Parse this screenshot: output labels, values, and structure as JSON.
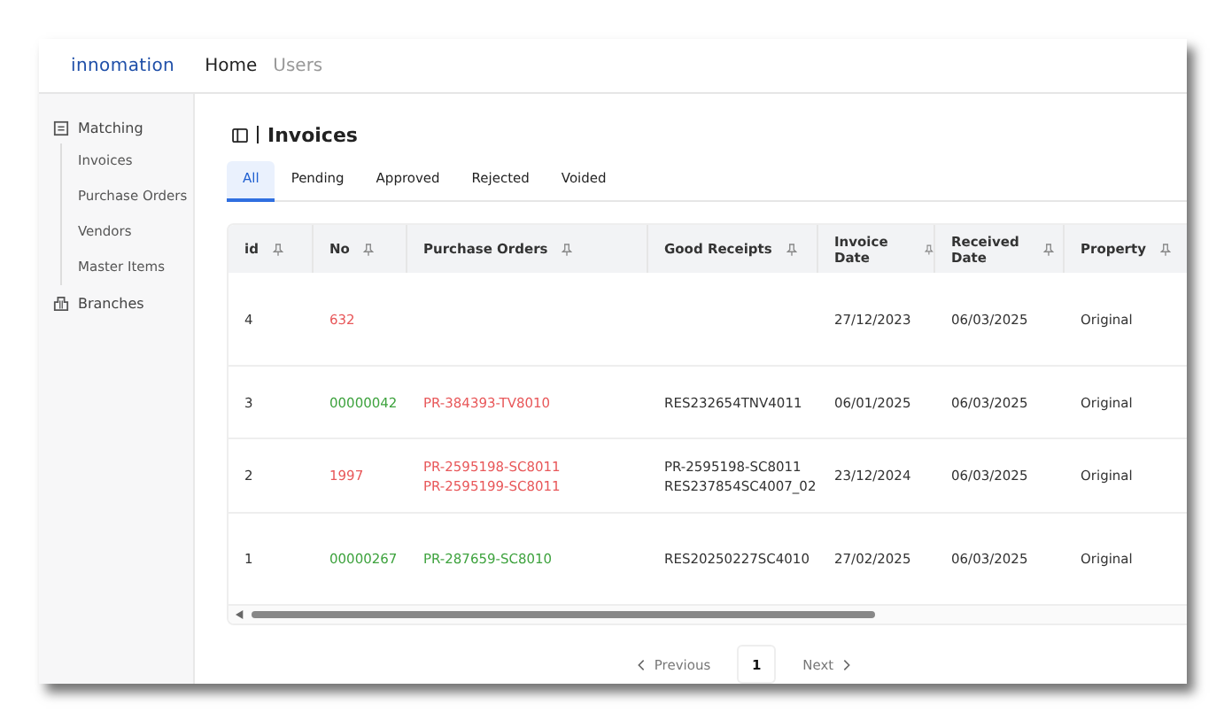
{
  "header": {
    "logo": "innomation",
    "nav": [
      {
        "label": "Home",
        "selected": true
      },
      {
        "label": "Users",
        "selected": false
      }
    ]
  },
  "sidebar": {
    "items": [
      {
        "label": "Matching",
        "kind": "group",
        "children": [
          {
            "label": "Invoices"
          },
          {
            "label": "Purchase Orders"
          },
          {
            "label": "Vendors"
          },
          {
            "label": "Master Items"
          }
        ]
      },
      {
        "label": "Branches",
        "kind": "link"
      }
    ]
  },
  "page": {
    "title": "Invoices"
  },
  "tabs": [
    {
      "label": "All",
      "selected": true
    },
    {
      "label": "Pending",
      "selected": false
    },
    {
      "label": "Approved",
      "selected": false
    },
    {
      "label": "Rejected",
      "selected": false
    },
    {
      "label": "Voided",
      "selected": false
    }
  ],
  "table": {
    "columns": [
      "id",
      "No",
      "Purchase Orders",
      "Good Receipts",
      "Invoice Date",
      "Received Date",
      "Property"
    ],
    "rows": [
      {
        "id": "4",
        "no": {
          "text": "632",
          "color": "#e8585a"
        },
        "purchase_orders": [],
        "good_receipts": [],
        "invoice_date": "27/12/2023",
        "received_date": "06/03/2025",
        "property": "Original"
      },
      {
        "id": "3",
        "no": {
          "text": "00000042",
          "color": "#3fa33f"
        },
        "purchase_orders": [
          {
            "text": "PR-384393-TV8010",
            "color": "#e8585a"
          }
        ],
        "good_receipts": [
          "RES232654TNV4011"
        ],
        "invoice_date": "06/01/2025",
        "received_date": "06/03/2025",
        "property": "Original"
      },
      {
        "id": "2",
        "no": {
          "text": "1997",
          "color": "#e8585a"
        },
        "purchase_orders": [
          {
            "text": "PR-2595198-SC8011",
            "color": "#e8585a"
          },
          {
            "text": "PR-2595199-SC8011",
            "color": "#e8585a"
          }
        ],
        "good_receipts": [
          "PR-2595198-SC8011",
          "RES237854SC4007_02"
        ],
        "invoice_date": "23/12/2024",
        "received_date": "06/03/2025",
        "property": "Original"
      },
      {
        "id": "1",
        "no": {
          "text": "00000267",
          "color": "#3fa33f"
        },
        "purchase_orders": [
          {
            "text": "PR-287659-SC8010",
            "color": "#3fa33f"
          }
        ],
        "good_receipts": [
          "RES20250227SC4010"
        ],
        "invoice_date": "27/02/2025",
        "received_date": "06/03/2025",
        "property": "Original"
      }
    ]
  },
  "pagination": {
    "previous": "Previous",
    "pages": [
      {
        "label": "1",
        "selected": true
      }
    ],
    "next": "Next"
  }
}
